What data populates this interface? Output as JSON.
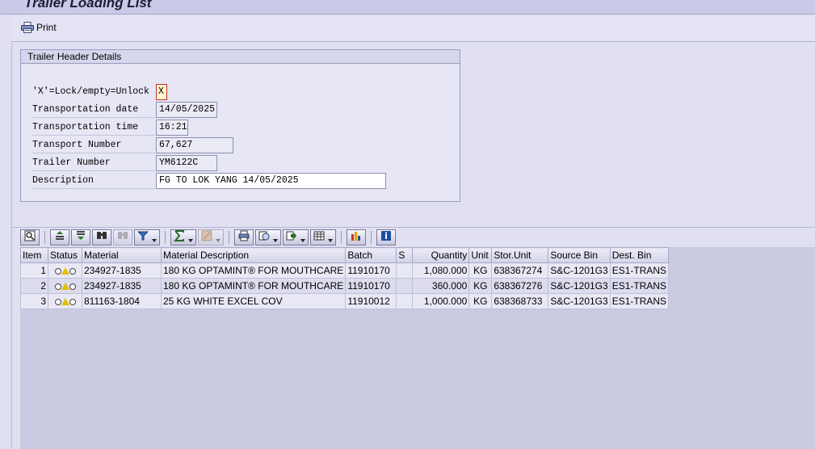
{
  "window": {
    "title": "Trailer Loading List"
  },
  "toolbar": {
    "print_label": "Print",
    "print_icon": "printer-icon"
  },
  "header": {
    "title": "Trailer Header Details",
    "fields": [
      {
        "label": "'X'=Lock/empty=Unlock",
        "value": "X"
      },
      {
        "label": "Transportation date",
        "value": "14/05/2025"
      },
      {
        "label": "Transportation time",
        "value": "16:21"
      },
      {
        "label": "Transport Number",
        "value": "67,627"
      },
      {
        "label": "Trailer Number",
        "value": "YM6122C"
      },
      {
        "label": "Description",
        "value": "FG TO LOK YANG 14/05/2025"
      }
    ]
  },
  "alv_toolbar": {
    "icons": [
      "details-icon",
      "sort-ascending-icon",
      "sort-descending-icon",
      "find-icon",
      "find-next-icon",
      "filter-icon",
      "sum-icon",
      "subtotal-icon",
      "print-preview-icon",
      "views-icon",
      "export-icon",
      "layout-icon",
      "graphic-icon",
      "information-icon"
    ]
  },
  "grid": {
    "columns": [
      "Item",
      "Status",
      "Material",
      "Material Description",
      "Batch",
      "S",
      "Quantity",
      "Unit",
      "Stor.Unit",
      "Source Bin",
      "Dest. Bin"
    ],
    "rows": [
      {
        "item": "1",
        "status": "yellow",
        "material": "234927-1835",
        "description": "180 KG OPTAMINT® FOR MOUTHCARE",
        "batch": "11910170",
        "s": "",
        "quantity": "1,080.000",
        "unit": "KG",
        "stor_unit": "638367274",
        "source_bin": "S&C-1201G3",
        "dest_bin": "ES1-TRANS"
      },
      {
        "item": "2",
        "status": "yellow",
        "material": "234927-1835",
        "description": "180 KG OPTAMINT® FOR MOUTHCARE",
        "batch": "11910170",
        "s": "",
        "quantity": "360.000",
        "unit": "KG",
        "stor_unit": "638367276",
        "source_bin": "S&C-1201G3",
        "dest_bin": "ES1-TRANS"
      },
      {
        "item": "3",
        "status": "yellow",
        "material": "811163-1804",
        "description": "25 KG WHITE EXCEL COV",
        "batch": "11910012",
        "s": "",
        "quantity": "1,000.000",
        "unit": "KG",
        "stor_unit": "638368733",
        "source_bin": "S&C-1201G3",
        "dest_bin": "ES1-TRANS"
      }
    ]
  },
  "colors": {
    "background": "#dfdff0",
    "status_yellow": "#e0c000",
    "header_focus_border": "#c03030"
  }
}
